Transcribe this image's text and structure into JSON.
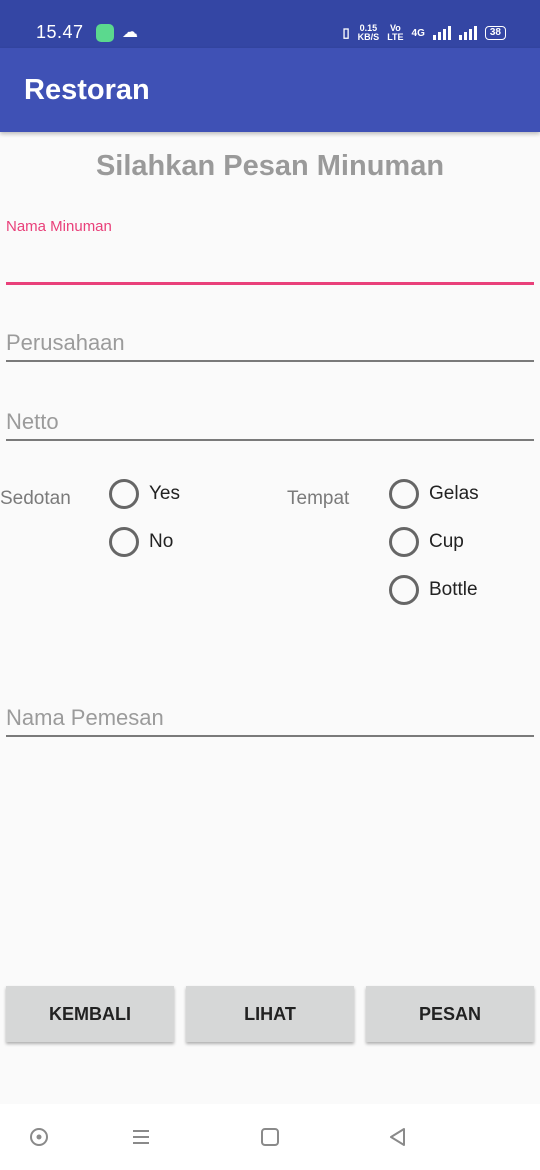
{
  "status_bar": {
    "time": "15.47",
    "network_speed_value": "0.15",
    "network_speed_unit": "KB/S",
    "volte_top": "Vo",
    "volte_bottom": "LTE",
    "network_type": "4G",
    "battery": "38"
  },
  "app_bar": {
    "title": "Restoran"
  },
  "page": {
    "heading": "Silahkan Pesan Minuman"
  },
  "form": {
    "nama_minuman": {
      "label": "Nama Minuman",
      "value": ""
    },
    "perusahaan": {
      "placeholder": "Perusahaan",
      "value": ""
    },
    "netto": {
      "placeholder": "Netto",
      "value": ""
    },
    "sedotan": {
      "label": "Sedotan",
      "options": [
        "Yes",
        "No"
      ],
      "selected": null
    },
    "tempat": {
      "label": "Tempat",
      "options": [
        "Gelas",
        "Cup",
        "Bottle"
      ],
      "selected": null
    },
    "nama_pemesan": {
      "placeholder": "Nama Pemesan",
      "value": ""
    }
  },
  "buttons": {
    "kembali": "KEMBALI",
    "lihat": "LIHAT",
    "pesan": "PESAN"
  },
  "colors": {
    "app_bar": "#3f51b5",
    "status_bar": "#3446a4",
    "accent": "#e9407a"
  },
  "nav_icons": [
    "screen-assistant-icon",
    "recent-apps-icon",
    "home-icon",
    "back-icon"
  ]
}
